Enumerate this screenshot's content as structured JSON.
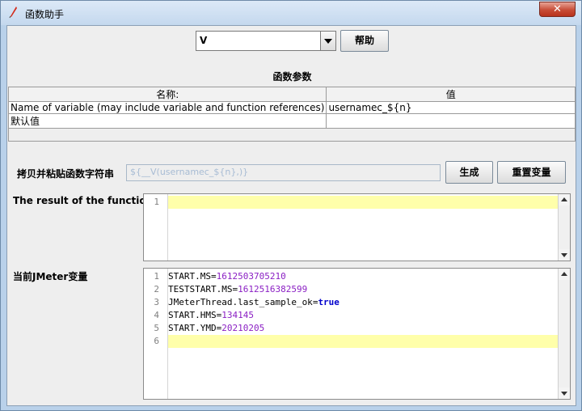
{
  "window": {
    "title": "函数助手",
    "close_label": "✕"
  },
  "function_select": {
    "value": "V"
  },
  "help_button": "帮助",
  "params": {
    "section_title": "函数参数",
    "columns": [
      "名称:",
      "值"
    ],
    "rows": [
      {
        "name": "Name of variable (may include variable and function references)",
        "value": "usernamec_${n}"
      },
      {
        "name": "默认值",
        "value": ""
      }
    ]
  },
  "copy": {
    "label": "拷贝并粘贴函数字符串",
    "value": "${__V(usernamec_${n},)}",
    "generate_button": "生成",
    "reset_button": "重置变量"
  },
  "result": {
    "label": "The result of the function is",
    "lines": [
      "1"
    ]
  },
  "variables": {
    "label": "当前JMeter变量",
    "lines": [
      {
        "no": "1",
        "key": "START.MS",
        "eq": "=",
        "val": "1612503705210"
      },
      {
        "no": "2",
        "key": "TESTSTART.MS",
        "eq": "=",
        "val": "1612516382599"
      },
      {
        "no": "3",
        "key": "JMeterThread.last_sample_ok",
        "eq": "=",
        "val": "true"
      },
      {
        "no": "4",
        "key": "START.HMS",
        "eq": "=",
        "val": "134145"
      },
      {
        "no": "5",
        "key": "START.YMD",
        "eq": "=",
        "val": "20210205"
      },
      {
        "no": "6",
        "key": "",
        "eq": "",
        "val": ""
      }
    ]
  },
  "colors": {
    "current_line": "#ffffaa",
    "number_value": "#8b20c4",
    "boolean_value": "#0000cc"
  }
}
